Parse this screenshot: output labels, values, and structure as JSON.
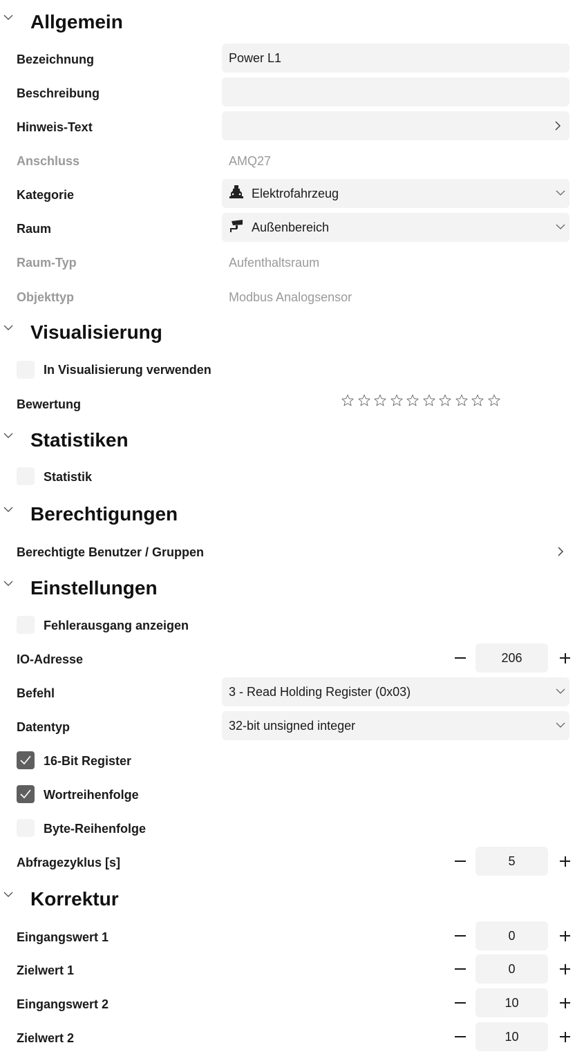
{
  "sections": {
    "allgemein": "Allgemein",
    "visualisierung": "Visualisierung",
    "statistiken": "Statistiken",
    "berechtigungen": "Berechtigungen",
    "einstellungen": "Einstellungen",
    "korrektur": "Korrektur"
  },
  "allgemein": {
    "bezeichnung_label": "Bezeichnung",
    "bezeichnung_value": "Power L1",
    "beschreibung_label": "Beschreibung",
    "beschreibung_value": "",
    "hinweis_label": "Hinweis-Text",
    "hinweis_value": "",
    "anschluss_label": "Anschluss",
    "anschluss_value": "AMQ27",
    "kategorie_label": "Kategorie",
    "kategorie_value": "Elektrofahrzeug",
    "kategorie_icon": "electric-vehicle-icon",
    "raum_label": "Raum",
    "raum_value": "Außenbereich",
    "raum_icon": "security-camera-icon",
    "raumtyp_label": "Raum-Typ",
    "raumtyp_value": "Aufenthaltsraum",
    "objekttyp_label": "Objekttyp",
    "objekttyp_value": "Modbus Analogsensor"
  },
  "visualisierung": {
    "use_label": "In Visualisierung verwenden",
    "use_checked": false,
    "bewertung_label": "Bewertung",
    "stars_total": 10,
    "stars_filled": 0
  },
  "statistiken": {
    "statistik_label": "Statistik",
    "statistik_checked": false
  },
  "berechtigungen": {
    "users_label": "Berechtigte Benutzer / Gruppen"
  },
  "einstellungen": {
    "fehlerausgang_label": "Fehlerausgang anzeigen",
    "fehlerausgang_checked": false,
    "io_label": "IO-Adresse",
    "io_value": "206",
    "befehl_label": "Befehl",
    "befehl_value": "3 - Read Holding Register (0x03)",
    "datentyp_label": "Datentyp",
    "datentyp_value": "32-bit unsigned integer",
    "reg16_label": "16-Bit Register",
    "reg16_checked": true,
    "wort_label": "Wortreihenfolge",
    "wort_checked": true,
    "byte_label": "Byte-Reihenfolge",
    "byte_checked": false,
    "zyklus_label": "Abfragezyklus [s]",
    "zyklus_value": "5"
  },
  "korrektur": {
    "ein1_label": "Eingangswert 1",
    "ein1_value": "0",
    "ziel1_label": "Zielwert 1",
    "ziel1_value": "0",
    "ein2_label": "Eingangswert 2",
    "ein2_value": "10",
    "ziel2_label": "Zielwert 2",
    "ziel2_value": "10"
  },
  "colors": {
    "field_bg": "#f3f3f3",
    "checkbox_checked": "#5f5f5f",
    "disabled_text": "#9a9a9a"
  }
}
